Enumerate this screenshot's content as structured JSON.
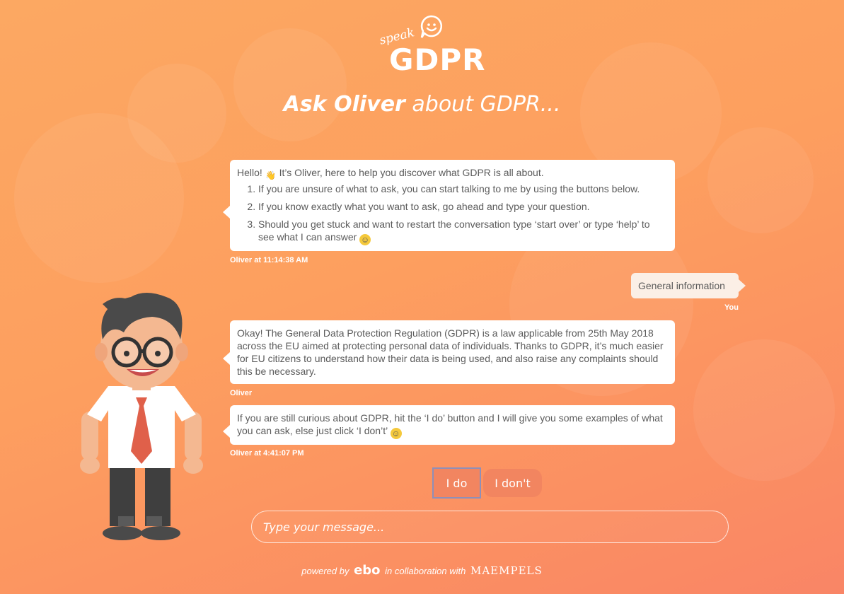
{
  "logo": {
    "speak": "speak",
    "gdpr": "GDPR"
  },
  "heading": {
    "bold": "Ask Oliver",
    "rest": " about GDPR..."
  },
  "messages": {
    "welcome": {
      "greeting": "Hello!",
      "greeting_rest": " It’s Oliver, here to help you discover what GDPR is all about.",
      "items": [
        "If you are unsure of what to ask, you can start talking to me by using the buttons below.",
        "If you know exactly what you want to ask, go ahead and type your question.",
        "Should you get stuck and want to restart the conversation type ‘start over’ or type ‘help’ to see what I can answer"
      ],
      "meta": "Oliver at 11:14:38 AM"
    },
    "user": {
      "text": "General information",
      "meta": "You"
    },
    "info": {
      "text": "Okay! The General Data Protection Regulation (GDPR) is a law applicable from 25th May 2018 across the EU aimed at protecting personal data of individuals. Thanks to GDPR, it’s much easier for EU citizens to understand how their data is being used, and also raise any complaints should this be necessary.",
      "meta": "Oliver"
    },
    "prompt": {
      "text": "If you are still curious about GDPR, hit the ‘I do’ button and I will give you some examples of what you can ask, else just click ‘I don’t’",
      "meta": "Oliver at 4:41:07 PM"
    }
  },
  "buttons": {
    "yes": "I do",
    "no": "I don't"
  },
  "input": {
    "placeholder": "Type your message..."
  },
  "footer": {
    "powered_by": "powered by",
    "ebo": "ebo",
    "collab": "in collaboration with",
    "partner": "MAEMPELS"
  },
  "colors": {
    "accent": "#f28560",
    "bubble": "#ffffff",
    "user_bubble": "#fbefe6",
    "text": "#5b5b5b"
  }
}
